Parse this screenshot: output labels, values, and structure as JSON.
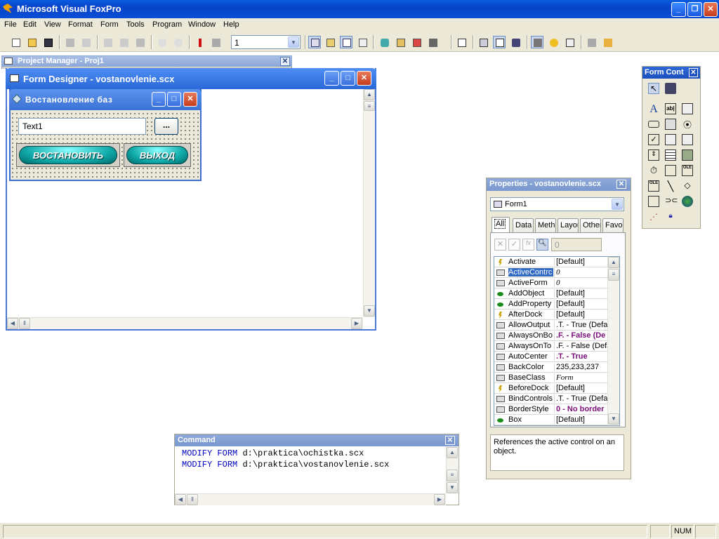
{
  "app": {
    "title": "Microsoft Visual FoxPro"
  },
  "menu": [
    "File",
    "Edit",
    "View",
    "Format",
    "Form",
    "Tools",
    "Program",
    "Window",
    "Help"
  ],
  "toolbar": {
    "combo_value": "1"
  },
  "project_manager": {
    "title": "Project Manager - Proj1"
  },
  "form_designer": {
    "title": "Form Designer - vostanovlenie.scx"
  },
  "form": {
    "title": "Востановление баз",
    "textbox_value": "Text1",
    "browse_label": "...",
    "restore_label": "ВОСТАНОВИТЬ",
    "exit_label": "ВЫХОД"
  },
  "form_controls": {
    "title": "Form Cont"
  },
  "properties": {
    "title": "Properties - vostanovlenie.scx",
    "object": "Form1",
    "tabs": [
      "All",
      "Data",
      "Meth",
      "Layou",
      "Other",
      "Favor"
    ],
    "value_field": "0",
    "fx_label": "fx",
    "rows": [
      {
        "name": "Activate",
        "value": "[Default]",
        "kind": "event"
      },
      {
        "name": "ActiveContrc",
        "value": "0",
        "kind": "prop",
        "italic": true,
        "selected": true
      },
      {
        "name": "ActiveForm",
        "value": "0",
        "kind": "prop",
        "italic": true
      },
      {
        "name": "AddObject",
        "value": "[Default]",
        "kind": "method"
      },
      {
        "name": "AddProperty",
        "value": "[Default]",
        "kind": "method"
      },
      {
        "name": "AfterDock",
        "value": "[Default]",
        "kind": "event"
      },
      {
        "name": "AllowOutput",
        "value": ".T. - True (Defau",
        "kind": "prop"
      },
      {
        "name": "AlwaysOnBo",
        "value": ".F. - False (De",
        "kind": "prop",
        "bold": true
      },
      {
        "name": "AlwaysOnTo",
        "value": ".F. - False (Defa",
        "kind": "prop"
      },
      {
        "name": "AutoCenter",
        "value": ".T. - True",
        "kind": "prop",
        "bold": true
      },
      {
        "name": "BackColor",
        "value": "235,233,237",
        "kind": "prop"
      },
      {
        "name": "BaseClass",
        "value": "Form",
        "kind": "prop",
        "italic": true
      },
      {
        "name": "BeforeDock",
        "value": "[Default]",
        "kind": "event"
      },
      {
        "name": "BindControls",
        "value": ".T. - True (Defau",
        "kind": "prop"
      },
      {
        "name": "BorderStyle",
        "value": "0 - No border",
        "kind": "prop",
        "bold": true
      },
      {
        "name": "Box",
        "value": "[Default]",
        "kind": "method"
      }
    ],
    "description": "References the active control on an object."
  },
  "command": {
    "title": "Command",
    "lines": [
      {
        "kw1": "MODIFY",
        "kw2": "FORM",
        "path": "d:\\praktica\\ochistka.scx"
      },
      {
        "kw1": "MODIFY",
        "kw2": "FORM",
        "path": "d:\\praktica\\vostanovlenie.scx"
      }
    ]
  },
  "status": {
    "num": "NUM"
  }
}
